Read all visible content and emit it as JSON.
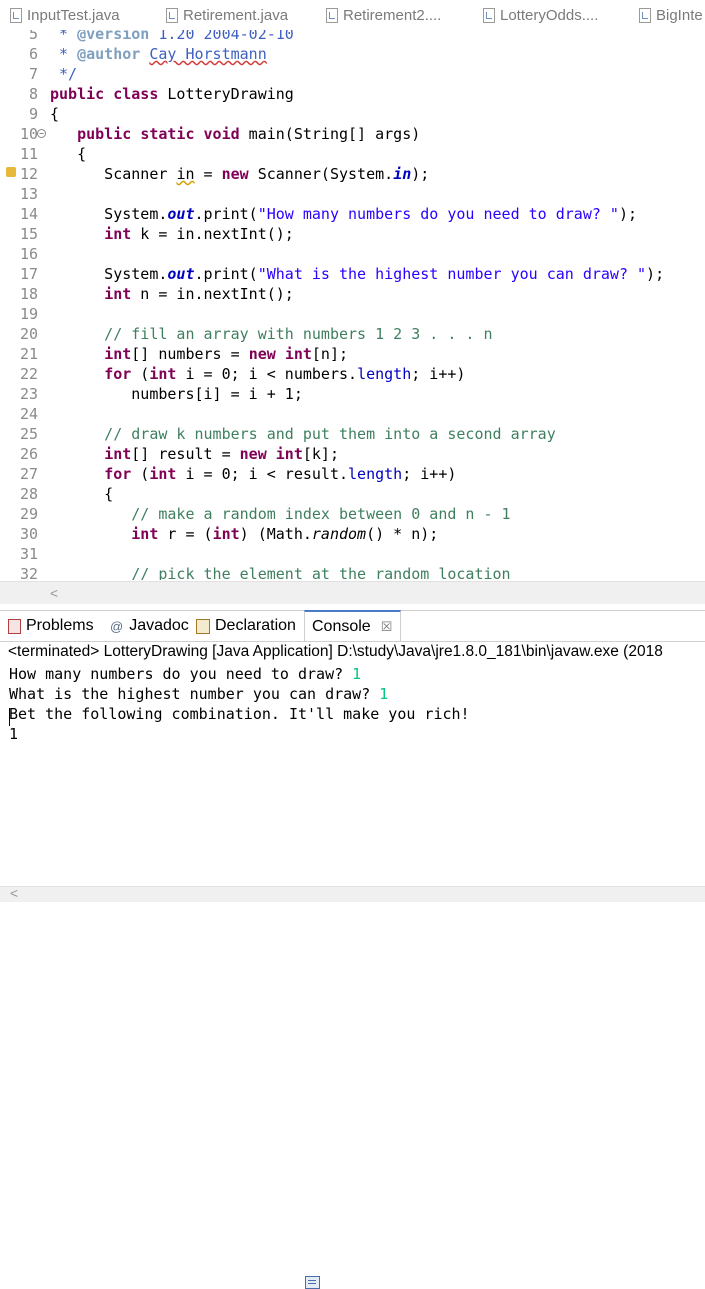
{
  "editor_tabs": [
    "InputTest.java",
    "Retirement.java",
    "Retirement2....",
    "LotteryOdds....",
    "BigInte"
  ],
  "code": {
    "lines": [
      {
        "n": "5",
        "text": " * @version 1.20 2004-02-10"
      },
      {
        "n": "6",
        "text": " * @author Cay Horstmann"
      },
      {
        "n": "7",
        "text": " */"
      },
      {
        "n": "8",
        "text": "public class LotteryDrawing"
      },
      {
        "n": "9",
        "text": "{"
      },
      {
        "n": "10",
        "text": "   public static void main(String[] args)"
      },
      {
        "n": "11",
        "text": "   {"
      },
      {
        "n": "12",
        "text": "      Scanner in = new Scanner(System.in);"
      },
      {
        "n": "13",
        "text": ""
      },
      {
        "n": "14",
        "text": "      System.out.print(\"How many numbers do you need to draw? \");"
      },
      {
        "n": "15",
        "text": "      int k = in.nextInt();"
      },
      {
        "n": "16",
        "text": ""
      },
      {
        "n": "17",
        "text": "      System.out.print(\"What is the highest number you can draw? \");"
      },
      {
        "n": "18",
        "text": "      int n = in.nextInt();"
      },
      {
        "n": "19",
        "text": ""
      },
      {
        "n": "20",
        "text": "      // fill an array with numbers 1 2 3 . . . n"
      },
      {
        "n": "21",
        "text": "      int[] numbers = new int[n];"
      },
      {
        "n": "22",
        "text": "      for (int i = 0; i < numbers.length; i++)"
      },
      {
        "n": "23",
        "text": "         numbers[i] = i + 1;"
      },
      {
        "n": "24",
        "text": ""
      },
      {
        "n": "25",
        "text": "      // draw k numbers and put them into a second array"
      },
      {
        "n": "26",
        "text": "      int[] result = new int[k];"
      },
      {
        "n": "27",
        "text": "      for (int i = 0; i < result.length; i++)"
      },
      {
        "n": "28",
        "text": "      {"
      },
      {
        "n": "29",
        "text": "         // make a random index between 0 and n - 1"
      },
      {
        "n": "30",
        "text": "         int r = (int) (Math.random() * n);"
      },
      {
        "n": "31",
        "text": ""
      },
      {
        "n": "32",
        "text": "         // pick the element at the random location"
      }
    ]
  },
  "panel_tabs": {
    "problems": "Problems",
    "javadoc_symbol": "@",
    "javadoc": "Javadoc",
    "declaration": "Declaration",
    "console": "Console",
    "close": "☒"
  },
  "console": {
    "status": "<terminated> LotteryDrawing [Java Application] D:\\study\\Java\\jre1.8.0_181\\bin\\javaw.exe (2018",
    "lines": [
      {
        "text": "How many numbers do you need to draw? ",
        "input": "1"
      },
      {
        "text": "What is the highest number you can draw? ",
        "input": "1"
      },
      {
        "text": "Bet the following combination. It'll make you rich!",
        "input": ""
      },
      {
        "text": "1",
        "input": ""
      }
    ]
  },
  "scroll_left_arrow": "<",
  "colors": {
    "keyword": "#7f0055",
    "string": "#2a00ff",
    "comment": "#3f7f5f",
    "console_input": "#00c87d",
    "active_tab": "#4a7bc8"
  }
}
